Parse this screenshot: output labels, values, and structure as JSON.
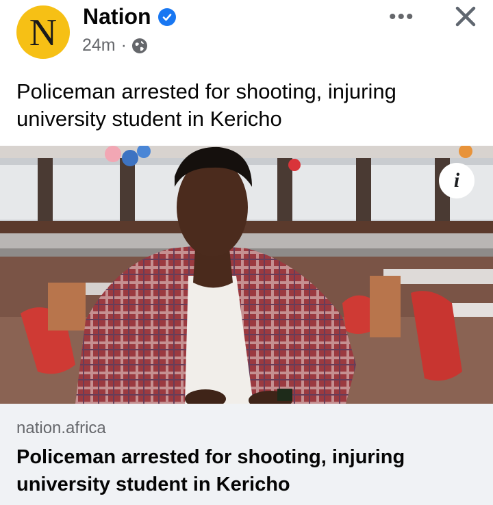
{
  "post": {
    "page_name": "Nation",
    "avatar_letter": "N",
    "time": "24m",
    "separator": "·",
    "privacy_icon": "globe-icon",
    "more_icon": "more-horizontal-icon",
    "more_label": "•••",
    "close_icon": "close-icon",
    "caption": "Policeman arrested for shooting, injuring university student in Kericho"
  },
  "link": {
    "domain": "nation.africa",
    "title": "Policeman arrested for shooting, injuring university student in Kericho",
    "info_label": "i"
  },
  "colors": {
    "avatar_bg": "#f6c015",
    "verified": "#1877f2",
    "card_bg": "#f0f2f5",
    "muted_text": "#65676b"
  }
}
